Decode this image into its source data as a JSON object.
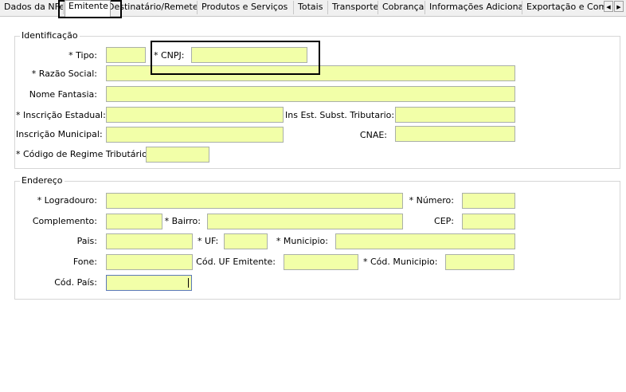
{
  "tabs": [
    "Dados da NFe",
    "Emitente",
    "Destinatário/Remetente",
    "Produtos e Serviços",
    "Totais",
    "Transporte",
    "Cobrança",
    "Informações Adicionais",
    "Exportação e Compra"
  ],
  "active_tab": "Emitente",
  "scroll_left_glyph": "◀",
  "scroll_right_glyph": "▶",
  "identificacao": {
    "legend": "Identificação",
    "tipo_label": "* Tipo:",
    "tipo_value": "",
    "cnpj_label": "* CNPJ:",
    "cnpj_value": "",
    "razao_label": "* Razão Social:",
    "razao_value": "",
    "fantasia_label": "Nome Fantasia:",
    "fantasia_value": "",
    "ie_label": "* Inscrição Estadual:",
    "ie_value": "",
    "iest_label": "Ins Est.  Subst. Tributario:",
    "iest_value": "",
    "im_label": "Inscrição Municipal:",
    "im_value": "",
    "cnae_label": "CNAE:",
    "cnae_value": "",
    "crt_label": "* Código de Regime Tributário:",
    "crt_value": ""
  },
  "endereco": {
    "legend": "Endereço",
    "logradouro_label": "* Logradouro:",
    "logradouro_value": "",
    "numero_label": "* Número:",
    "numero_value": "",
    "complemento_label": "Complemento:",
    "complemento_value": "",
    "bairro_label": "* Bairro:",
    "bairro_value": "",
    "cep_label": "CEP:",
    "cep_value": "",
    "pais_label": "Pais:",
    "pais_value": "",
    "uf_label": "* UF:",
    "uf_value": "",
    "municipio_label": "* Municipio:",
    "municipio_value": "",
    "fone_label": "Fone:",
    "fone_value": "",
    "cod_uf_label": "Cód. UF Emitente:",
    "cod_uf_value": "",
    "cod_municipio_label": "* Cód. Municipio:",
    "cod_municipio_value": "",
    "cod_pais_label": "Cód. País:",
    "cod_pais_value": ""
  }
}
